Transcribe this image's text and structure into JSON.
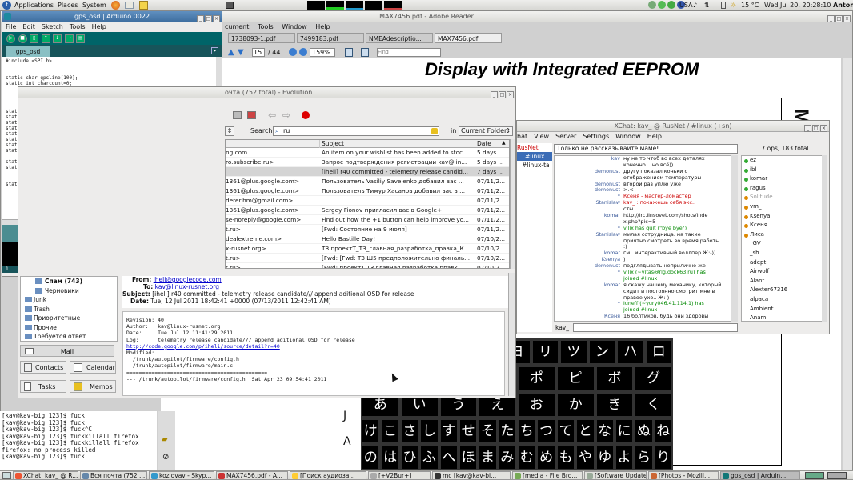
{
  "top_panel": {
    "applications": "Applications",
    "places": "Places",
    "system": "System",
    "temp": "15 °C",
    "clock": "Wed Jul 20, 20:28:10",
    "user": "Anton",
    "kbd": "USA"
  },
  "reader": {
    "title": "MAX7456.pdf - Adobe Reader",
    "menu": [
      "cument",
      "Tools",
      "Window",
      "Help"
    ],
    "tabs": [
      "1738093-1.pdf",
      "7499183.pdf",
      "NMEAdescriptio...",
      "MAX7456.pdf"
    ],
    "page": "15",
    "pages": "/ 44",
    "zoom": "159%",
    "find_placeholder": "Find",
    "heading": "Display with Integrated EEPROM",
    "rotated": "M",
    "letters": [
      "J",
      "A"
    ],
    "kana": [
      [
        "ス",
        "ホ",
        "ペ",
        "ユ",
        "エ",
        "ヨ",
        "リ",
        "ツ",
        "ン",
        "ハ",
        "ロ"
      ],
      [
        "ワ",
        "ン",
        "ビ",
        "ブ",
        "ポ",
        "ピ",
        "ボ",
        "グ"
      ],
      [
        "あ",
        "い",
        "う",
        "え",
        "お",
        "か",
        "き",
        "く"
      ],
      [
        "け",
        "こ",
        "さ",
        "し",
        "す",
        "せ",
        "そ",
        "た",
        "ち",
        "つ",
        "て",
        "と",
        "な",
        "に",
        "ぬ",
        "ね"
      ],
      [
        "の",
        "は",
        "ひ",
        "ふ",
        "へ",
        "ほ",
        "ま",
        "み",
        "む",
        "め",
        "も",
        "や",
        "ゆ",
        "よ",
        "ら",
        "り"
      ]
    ]
  },
  "arduino": {
    "title": "gps_osd | Arduino 0022",
    "menu": [
      "File",
      "Edit",
      "Sketch",
      "Tools",
      "Help"
    ],
    "tab": "gps_osd",
    "status_line": "1",
    "code": [
      "#include <SPI.h>",
      "",
      "",
      "static char gpsline[100];",
      "static int charcount=0;",
      "",
      "",
      "",
      "",
      "static long gps_time=1;",
      "static long gps_lat=1;",
      "static long gps_long=1;",
      "static long gps_alt=1;",
      "static long gps_ht=1;",
      "static long gps_km=1;",
      "static int gps_fix=0;",
      "static int last_gps_fix=0;",
      "",
      "static long init_gps_lat=1;",
      "static long init_gps_long=1;",
      "",
      "",
      "static uint8_t gps_updated=0;"
    ]
  },
  "evolution": {
    "title": "очта (752 total) - Evolution",
    "search_label": "Search:",
    "search_value": "ru",
    "in_label": "in",
    "folder": "Current Folder",
    "col_subject": "Subject",
    "col_date": "Date",
    "rows": [
      {
        "from": "ng.com",
        "subject": "An item on your wishlist has been added to stoc...",
        "date": "5 days ..."
      },
      {
        "from": "ro.subscribe.ru>",
        "subject": "Запрос подтверждения регистрации kav@lin...",
        "date": "5 days ..."
      },
      {
        "from": "",
        "subject": "[iheli] r40 committed - telemetry release candid...",
        "date": "7 days ..."
      },
      {
        "from": "1361@plus.google.com>",
        "subject": "Пользователь Vasiliy Savelenko добавил вас ...",
        "date": "07/11/2..."
      },
      {
        "from": "1361@plus.google.com>",
        "subject": "Пользователь Тимур Хасанов добавил вас в ...",
        "date": "07/11/2..."
      },
      {
        "from": "derer.hm@gmail.com>",
        "subject": "",
        "date": "07/11/2..."
      },
      {
        "from": "1361@plus.google.com>",
        "subject": "Sergey Fionov пригласил вас в Google+",
        "date": "07/11/2..."
      },
      {
        "from": "se-noreply@google.com>",
        "subject": "Find out how the +1 button can help improve yo...",
        "date": "07/11/2..."
      },
      {
        "from": "t.ru>",
        "subject": "[Fwd: Состояние на 9 июля]",
        "date": "07/11/2..."
      },
      {
        "from": "dealextreme.com>",
        "subject": "Hello Bastille Day!",
        "date": "07/10/2..."
      },
      {
        "from": "x-rusnet.org>",
        "subject": "ТЗ проектТ_ТЗ_главная_разработка_правка_К...",
        "date": "07/10/2..."
      },
      {
        "from": "t.ru>",
        "subject": "[Fwd: [Fwd: ТЗ Ш5 предположительно финаль...",
        "date": "07/10/2..."
      },
      {
        "from": "t.ru>",
        "subject": "[Fwd: проектТ ТЗ главная разработка правк...",
        "date": "07/10/2..."
      }
    ],
    "folders": [
      {
        "name": "Спам (743)",
        "bold": true
      },
      {
        "name": "Черновики"
      },
      {
        "name": "Junk"
      },
      {
        "name": "Trash"
      },
      {
        "name": "Приоритетные"
      },
      {
        "name": "Прочие"
      },
      {
        "name": "Требуется ответ"
      }
    ],
    "switcher": {
      "mail": "Mail",
      "contacts": "Contacts",
      "calendar": "Calendar",
      "tasks": "Tasks",
      "memos": "Memos"
    },
    "preview": {
      "from_label": "From:",
      "from": "iheli@googlecode.com",
      "to_label": "To:",
      "to": "kav@linux-rusnet.org",
      "subject_label": "Subject:",
      "subject": "[iheli] r40 committed - telemetry release candidate/// append aditional OSD for release",
      "date_label": "Date:",
      "date": "Tue, 12 Jul 2011 18:42:41 +0000 (07/13/2011 12:42:41 AM)",
      "body": [
        "Revision: 40",
        "Author:   kav@linux-rusnet.org",
        "Date:     Tue Jul 12 11:41:29 2011",
        "Log:      telemetry release candidate/// append aditional OSD for release",
        "http://code.google.com/p/iheli/source/detail?r=40",
        "",
        "Modified:",
        "  /trunk/autopilot/firmware/config.h",
        "  /trunk/autopilot/firmware/main.c",
        "",
        "=============================================",
        "--- /trunk/autopilot/firmware/config.h  Sat Apr 23 09:54:41 2011"
      ]
    }
  },
  "terminal": {
    "lines": [
      "[kav@kav-big 123]$ fuck",
      "[kav@kav-big 123]$ fuck",
      "[kav@kav-big 123]$ fuck^C",
      "[kav@kav-big 123]$ fuckkillall firefox",
      "[kav@kav-big 123]$ fuckkillall firefox",
      "firefox: no process killed",
      "[kav@kav-big 123]$ fuck"
    ]
  },
  "xchat": {
    "title": "XChat: kav_ @ RusNet / #linux (+sn)",
    "menu": [
      "hat",
      "View",
      "Server",
      "Settings",
      "Window",
      "Help"
    ],
    "tree": [
      "RusNet",
      "#linux",
      "#linux-ta"
    ],
    "topic": "Только не рассказывайте маме!",
    "ops": "7 ops, 183 total",
    "nick": "kav_",
    "lines": [
      {
        "n": "kav",
        "t": "ну не то чтоб во всех деталях"
      },
      {
        "n": "",
        "t": "конечно... но всё))"
      },
      {
        "n": "demonust",
        "t": "другу показал коньки с"
      },
      {
        "n": "",
        "t": "отображением температуры"
      },
      {
        "n": "demonust",
        "t": "второй раз уплю уже"
      },
      {
        "n": "demonust",
        "t": ">.<"
      },
      {
        "n": "*",
        "t": "Ксеня - мастер-ломастер",
        "c": "#c00"
      },
      {
        "n": "Stanislaw",
        "t": "kav_ : покажешь себя экс..",
        "c": "#c00"
      },
      {
        "n": "",
        "t": "сты"
      },
      {
        "n": "komar",
        "t": "http://irc.linsovet.com/shots/inde"
      },
      {
        "n": "",
        "t": "x.php?pic=5"
      },
      {
        "n": "*",
        "t": "vilix has quit (\"bye bye\")",
        "c": "#080"
      },
      {
        "n": "Stanislaw",
        "t": "милая сотрудница. на такие"
      },
      {
        "n": "",
        "t": "приятно смотреть во время работы"
      },
      {
        "n": "",
        "t": ":)"
      },
      {
        "n": "komar",
        "t": "гм.. интерактивный воллпер Ж:-))"
      },
      {
        "n": "Ksenya",
        "t": ")"
      },
      {
        "n": "demonust",
        "t": "подглядывать неприлично же"
      },
      {
        "n": "*",
        "t": "vilix (~vitas@rig.dock63.ru) has",
        "c": "#080"
      },
      {
        "n": "",
        "t": "joined #linux",
        "c": "#080"
      },
      {
        "n": "komar",
        "t": "я скажу нашему механику, который"
      },
      {
        "n": "",
        "t": "сидит и постоянно смотрит мне в"
      },
      {
        "n": "",
        "t": "правое ухо.. Ж:-)"
      },
      {
        "n": "*",
        "t": "luneff (~yury046.41.114.1) has",
        "c": "#080"
      },
      {
        "n": "",
        "t": "joined #linux",
        "c": "#080"
      },
      {
        "n": "Ксеня",
        "t": "16 болтиков, будь они здоровы"
      }
    ],
    "users": [
      "ez",
      "ibl",
      "komar",
      "ragus",
      "Solitude",
      "vm_",
      "Ksenya",
      "Ксеня",
      "Лиса",
      "_GV",
      "_sh",
      "adept",
      "Airwolf",
      "Alant",
      "Alexter67316",
      "alpaca",
      "Ambient",
      "Anami"
    ]
  },
  "taskbar": [
    "XChat: kav_ @ R...",
    "Вся почта (752 ...",
    "kozlovav - Skyp...",
    "MAX7456.pdf - A...",
    "[Поиск аудиоза...",
    "[+V2Bur+]",
    "mc [kav@kav-bi...",
    "[media - File Bro...",
    "[Software Update]",
    "[Photos - Mozill...",
    "gps_osd | Arduin..."
  ]
}
